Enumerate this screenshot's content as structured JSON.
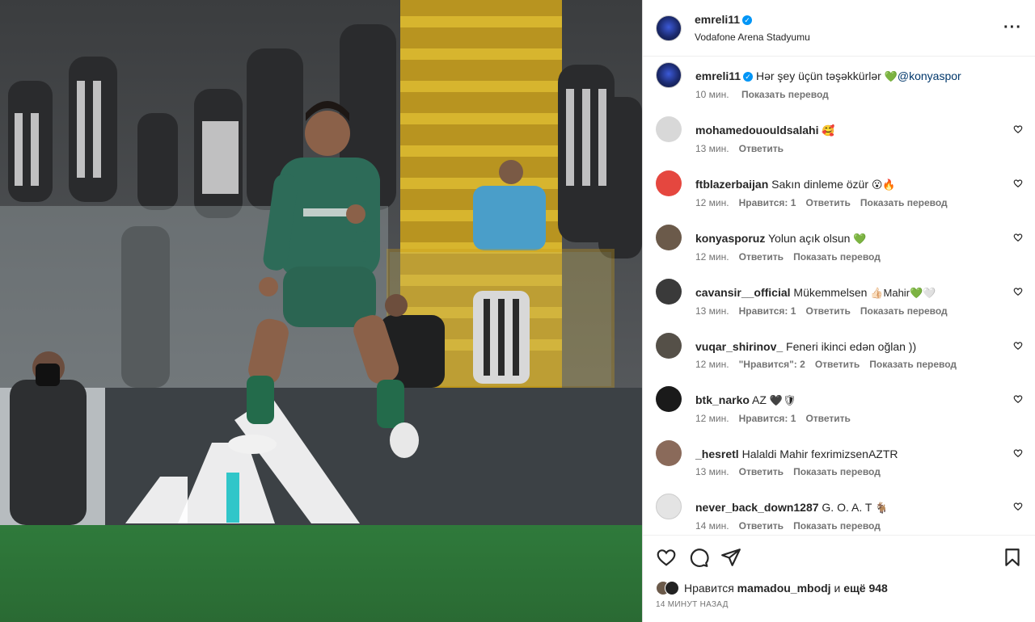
{
  "post": {
    "author": "emreli11",
    "location": "Vodafone Arena Stadyumu",
    "caption": {
      "user": "emreli11",
      "text": "Hər şey üçün təşəkkürlər",
      "emoji": "💚",
      "mention": "@konyaspor",
      "time": "10 мин.",
      "translate": "Показать перевод"
    }
  },
  "comments": [
    {
      "user": "mohamedououldsalahi",
      "text": "",
      "emoji": "🥰",
      "time": "13 мин.",
      "likes": "",
      "reply": "Ответить",
      "translate": "",
      "avatar_color": "#d8d8d8"
    },
    {
      "user": "ftblazerbaijan",
      "text": "Sakın dinleme özür",
      "emoji": "😮🔥",
      "time": "12 мин.",
      "likes": "Нравится: 1",
      "reply": "Ответить",
      "translate": "Показать перевод",
      "avatar_color": "#e5473f"
    },
    {
      "user": "konyasporuz",
      "text": "Yolun açık olsun",
      "emoji": "💚",
      "time": "12 мин.",
      "likes": "",
      "reply": "Ответить",
      "translate": "Показать перевод",
      "avatar_color": "#6b5a4a"
    },
    {
      "user": "cavansir__official",
      "text": "Mükemmelsen",
      "emoji": "👍🏻Mahir💚🤍",
      "time": "13 мин.",
      "likes": "Нравится: 1",
      "reply": "Ответить",
      "translate": "Показать перевод",
      "avatar_color": "#3a3a3a"
    },
    {
      "user": "vuqar_shirinov_",
      "text": "Feneri ikinci edən oğlan ))",
      "emoji": "",
      "time": "12 мин.",
      "likes": "\"Нравится\": 2",
      "reply": "Ответить",
      "translate": "Показать перевод",
      "avatar_color": "#555048"
    },
    {
      "user": "btk_narko",
      "text": "AZ",
      "emoji": "🖤🛡",
      "time": "12 мин.",
      "likes": "Нравится: 1",
      "reply": "Ответить",
      "translate": "",
      "avatar_color": "#1a1a1a"
    },
    {
      "user": "_hesretl",
      "text": "Halaldi Mahir fexrimizsenAZTR",
      "emoji": "",
      "time": "13 мин.",
      "likes": "",
      "reply": "Ответить",
      "translate": "Показать перевод",
      "avatar_color": "#8a6a5a"
    },
    {
      "user": "never_back_down1287",
      "text": "G. O. A. T",
      "emoji": "🐐",
      "time": "14 мин.",
      "likes": "",
      "reply": "Ответить",
      "translate": "Показать перевод",
      "avatar_color": "#e4e4e4"
    }
  ],
  "footer": {
    "likes_prefix": "Нравится",
    "likes_user": "mamadou_mbodj",
    "likes_mid": "и",
    "likes_rest": "ещё 948",
    "time_ago": "14 МИНУТ НАЗАД"
  },
  "icons": {
    "like": "heart-icon",
    "comment": "comment-icon",
    "share": "share-icon",
    "save": "bookmark-icon",
    "more": "more-options-icon"
  },
  "colors": {
    "accent": "#0095f6",
    "mention": "#00376b",
    "meta": "#737373"
  }
}
